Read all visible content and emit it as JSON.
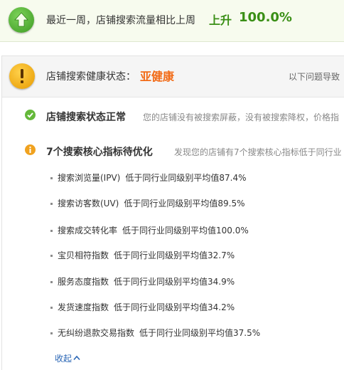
{
  "top": {
    "text": "最近一周，店铺搜索流量相比上周",
    "status": "上升",
    "percent": "100.0%"
  },
  "health": {
    "label": "店铺搜索健康状态：",
    "value": "亚健康",
    "note": "以下问题导致"
  },
  "status_ok": {
    "title": "店铺搜索状态正常",
    "desc": "您的店铺没有被搜索屏蔽，没有被搜索降权，价格指"
  },
  "core": {
    "title": "7个搜索核心指标待优化",
    "desc": "发现您的店铺有7个搜索核心指标低于同行业"
  },
  "metrics": [
    {
      "name": "搜索浏览量(IPV)",
      "value": "低于同行业同级别平均值87.4%"
    },
    {
      "name": "搜索访客数(UV)",
      "value": "低于同行业同级别平均值89.5%"
    },
    {
      "name": "搜索成交转化率",
      "value": "低于同行业同级别平均值100.0%"
    },
    {
      "name": "宝贝相符指数",
      "value": "低于同行业同级别平均值32.7%"
    },
    {
      "name": "服务态度指数",
      "value": "低于同行业同级别平均值34.9%"
    },
    {
      "name": "发货速度指数",
      "value": "低于同行业同级别平均值34.2%"
    },
    {
      "name": "无纠纷退款交易指数",
      "value": "低于同行业同级别平均值37.5%"
    }
  ],
  "collapse_label": "收起",
  "icons": {
    "trend": "arrow-up-icon",
    "health": "exclamation-icon",
    "ok": "check-icon",
    "info": "info-icon",
    "collapse": "chevron-up-icon"
  },
  "colors": {
    "trend_green": "#3a8f16",
    "health_orange": "#f26b17",
    "link_blue": "#2a66b5"
  }
}
